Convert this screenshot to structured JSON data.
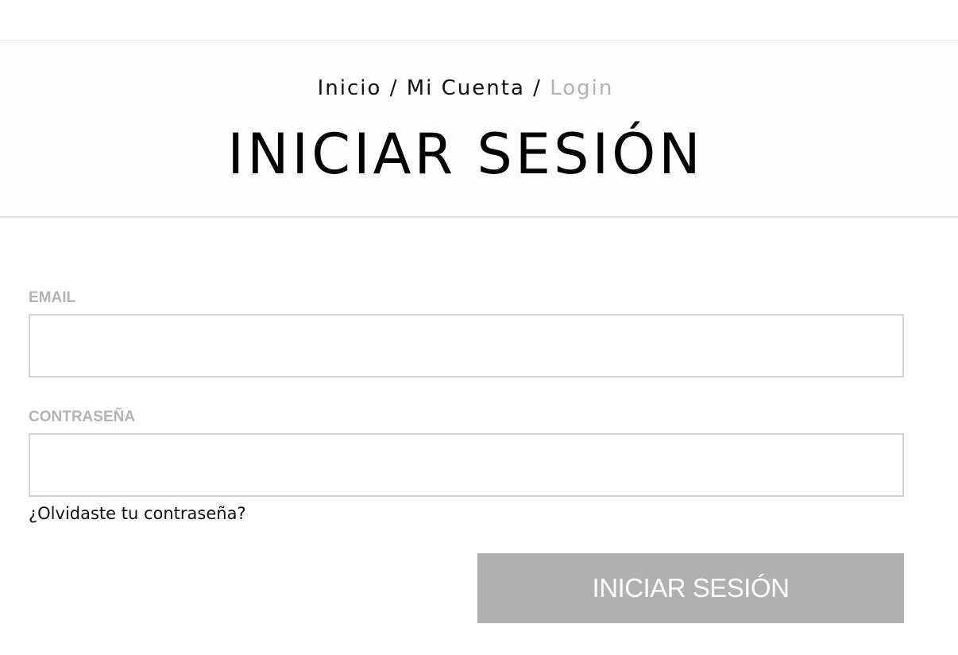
{
  "breadcrumb": {
    "items": [
      "Inicio",
      "Mi Cuenta"
    ],
    "separator": "/",
    "current": "Login"
  },
  "page": {
    "title": "INICIAR SESIÓN"
  },
  "form": {
    "email_label": "EMAIL",
    "email_value": "",
    "password_label": "CONTRASEÑA",
    "password_value": "",
    "forgot_link": "¿Olvidaste tu contraseña?",
    "submit_label": "INICIAR SESIÓN"
  },
  "colors": {
    "label_gray": "#b3b3b3",
    "button_bg": "#b0b0b0",
    "input_border": "#d4d4d4",
    "text": "#111111"
  }
}
